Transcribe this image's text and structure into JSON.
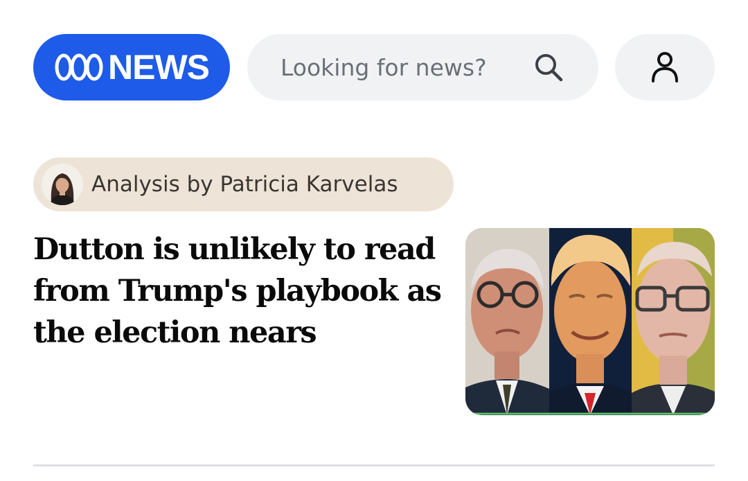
{
  "header": {
    "logo_text": "NEWS",
    "brand_color": "#1e5be8",
    "search": {
      "placeholder": "Looking for news?",
      "value": ""
    },
    "icons": {
      "search": "search-icon",
      "account": "account-icon"
    }
  },
  "story": {
    "byline": {
      "label": "Analysis by Patricia Karvelas",
      "background": "#ede4d7"
    },
    "headline": "Dutton is unlikely to read from Trump's playbook as the election nears"
  }
}
